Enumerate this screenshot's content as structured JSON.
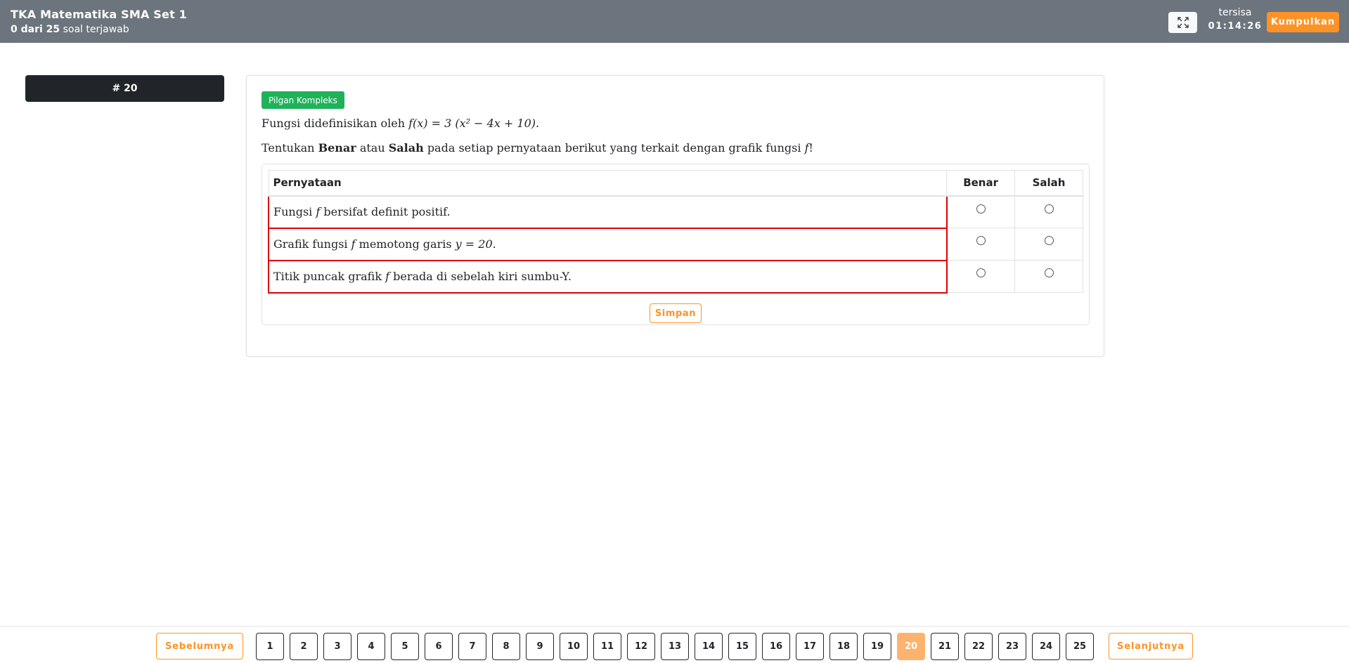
{
  "header": {
    "title": "TKA Matematika SMA Set 1",
    "answered_count": "0 dari 25",
    "answered_suffix": "soal terjawab",
    "timer_label": "tersisa",
    "timer_value": "01:14:26",
    "submit_label": "Kumpulkan",
    "fullscreen_icon": "expand-icon"
  },
  "question": {
    "number_label": "# 20",
    "type_badge": "Pilgan Kompleks",
    "line1_prefix": "Fungsi didefinisikan oleh",
    "line1_math": "f(x) = 3 (x² − 4x + 10).",
    "line2": {
      "part1": "Tentukan",
      "benar": "Benar",
      "part2": "atau",
      "salah": "Salah",
      "part3": "pada setiap pernyataan berikut yang terkait dengan grafik fungsi",
      "var": "f",
      "end": "!"
    },
    "table": {
      "headers": [
        "Pernyataan",
        "Benar",
        "Salah"
      ],
      "rows": [
        {
          "pre": "Fungsi",
          "var": "f",
          "post": "bersifat definit positif."
        },
        {
          "pre": "Grafik fungsi",
          "var": "f",
          "post": "memotong garis",
          "math": "y = 20",
          "end": "."
        },
        {
          "pre": "Titik puncak grafik",
          "var": "f",
          "post": "berada di sebelah kiri sumbu-Y."
        }
      ]
    },
    "save_label": "Simpan"
  },
  "footer": {
    "prev_label": "Sebelumnya",
    "next_label": "Selanjutnya",
    "pages": [
      "1",
      "2",
      "3",
      "4",
      "5",
      "6",
      "7",
      "8",
      "9",
      "10",
      "11",
      "12",
      "13",
      "14",
      "15",
      "16",
      "17",
      "18",
      "19",
      "20",
      "21",
      "22",
      "23",
      "24",
      "25"
    ],
    "active_page": "20"
  },
  "colors": {
    "header_bg": "#6c757d",
    "accent": "#fd9326",
    "badge": "#20b15b",
    "active_page": "#fdb36e",
    "highlight": "#e00000"
  }
}
